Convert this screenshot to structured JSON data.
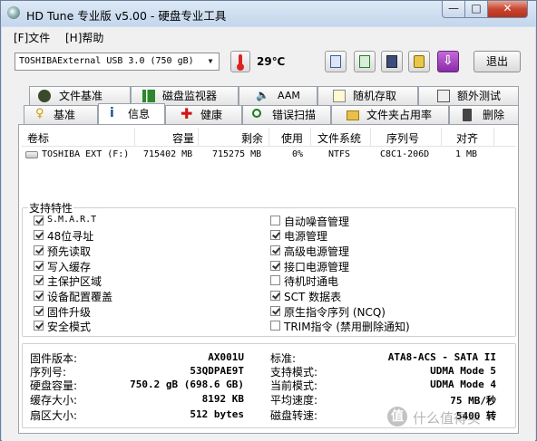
{
  "window": {
    "title": "HD Tune 专业版 v5.00 - 硬盘专业工具",
    "min_glyph": "—",
    "max_glyph": "□",
    "close_glyph": "✕"
  },
  "menu": {
    "file": "[F]文件",
    "help": "[H]帮助"
  },
  "toolbar": {
    "drive": "TOSHIBAExternal USB 3.0 (750 gB)",
    "temperature": "29℃",
    "exit_label": "退出",
    "icons": [
      "copy-icon",
      "copy-all-icon",
      "save-icon",
      "options-icon",
      "download-icon"
    ]
  },
  "tabs": {
    "row1": [
      "文件基准",
      "磁盘监视器",
      "AAM",
      "随机存取",
      "额外测试"
    ],
    "row2": [
      "基准",
      "信息",
      "健康",
      "错误扫描",
      "文件夹占用率",
      "删除"
    ],
    "active": "信息"
  },
  "partitions": {
    "columns": [
      "卷标",
      "容量",
      "剩余",
      "使用",
      "文件系统",
      "序列号",
      "对齐"
    ],
    "rows": [
      {
        "label": "TOSHIBA EXT (F:)",
        "capacity": "715402 MB",
        "free": "715275 MB",
        "used": "0%",
        "fs": "NTFS",
        "serial": "C8C1-206D",
        "align": "1 MB"
      }
    ]
  },
  "features": {
    "title": "支持特性",
    "left": [
      {
        "label": "S.M.A.R.T",
        "checked": true
      },
      {
        "label": "48位寻址",
        "checked": true
      },
      {
        "label": "预先读取",
        "checked": true
      },
      {
        "label": "写入缓存",
        "checked": true
      },
      {
        "label": "主保护区域",
        "checked": true
      },
      {
        "label": "设备配置覆盖",
        "checked": true
      },
      {
        "label": "固件升级",
        "checked": true
      },
      {
        "label": "安全模式",
        "checked": true
      }
    ],
    "right": [
      {
        "label": "自动噪音管理",
        "checked": false
      },
      {
        "label": "电源管理",
        "checked": true
      },
      {
        "label": "高级电源管理",
        "checked": true
      },
      {
        "label": "接口电源管理",
        "checked": true
      },
      {
        "label": "待机时通电",
        "checked": false
      },
      {
        "label": "SCT 数据表",
        "checked": true
      },
      {
        "label": "原生指令序列 (NCQ)",
        "checked": true
      },
      {
        "label": "TRIM指令 (禁用删除通知)",
        "checked": false
      }
    ]
  },
  "info": {
    "left": [
      {
        "key": "固件版本:",
        "value": "AX001U"
      },
      {
        "key": "序列号:",
        "value": "53QDPAE9T"
      },
      {
        "key": "硬盘容量:",
        "value": "750.2 gB (698.6 GB)"
      },
      {
        "key": "缓存大小:",
        "value": "8192 KB"
      },
      {
        "key": "扇区大小:",
        "value": "512 bytes"
      }
    ],
    "right": [
      {
        "key": "标准:",
        "value": "ATA8-ACS - SATA II"
      },
      {
        "key": "支持模式:",
        "value": "UDMA Mode 5"
      },
      {
        "key": "当前模式:",
        "value": "UDMA Mode 4"
      },
      {
        "key": "平均速度:",
        "value": "75 MB/秒"
      },
      {
        "key": "磁盘转速:",
        "value": "5400 转"
      }
    ]
  },
  "watermark": {
    "glyph": "值",
    "text": "什么值得买"
  }
}
